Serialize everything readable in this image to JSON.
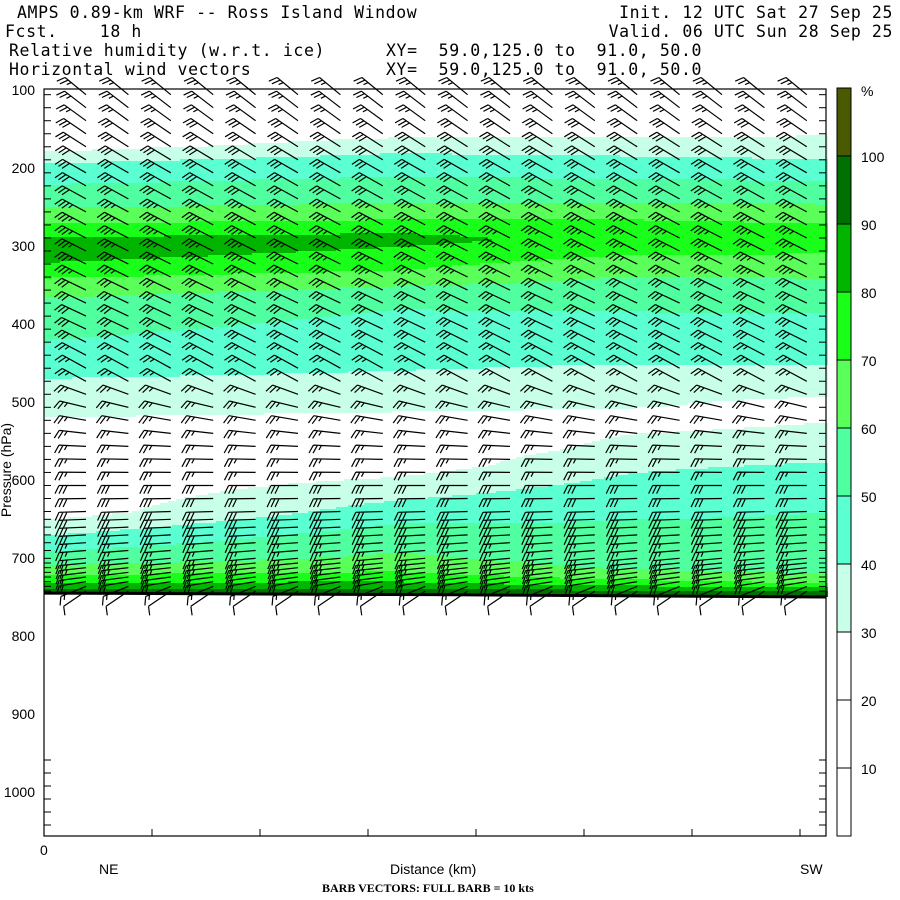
{
  "header": {
    "title": "AMPS 0.89-km WRF -- Ross Island Window",
    "init": "Init. 12 UTC Sat 27 Sep 25",
    "fcst": "Fcst.    18 h",
    "valid": "Valid. 06 UTC Sun 28 Sep 25",
    "field1": "Relative humidity (w.r.t. ice)",
    "field1_xy": "XY=  59.0,125.0 to  91.0, 50.0",
    "field2": "Horizontal wind vectors",
    "field2_xy": "XY=  59.0,125.0 to  91.0, 50.0"
  },
  "chart_data": {
    "type": "heatmap",
    "title": "Relative humidity (w.r.t. ice) and horizontal wind vectors cross-section",
    "ylabel": "Pressure (hPa)",
    "ylim": [
      100,
      1056
    ],
    "y_tick_values": [
      100,
      200,
      300,
      400,
      500,
      600,
      700,
      800,
      900,
      1000
    ],
    "y_ticks": [
      "100",
      "200",
      "300",
      "400",
      "500",
      "600",
      "700",
      "800",
      "900",
      "1000"
    ],
    "x_origin_label": "0",
    "x_left_label": "NE",
    "xlabel": "Distance (km)",
    "x_right_label": "SW",
    "x_major_ticks": 7,
    "footer": "BARB VECTORS:  FULL BARB = 10 kts",
    "colorbar": {
      "unit": "%",
      "levels": [
        10,
        20,
        30,
        40,
        50,
        60,
        70,
        80,
        90,
        100
      ],
      "labels": [
        "10",
        "20",
        "30",
        "40",
        "50",
        "60",
        "70",
        "80",
        "90",
        "100"
      ],
      "colors": [
        "#ffffff",
        "#ffffff",
        "#ffffff",
        "#c8ffe8",
        "#5affd2",
        "#50ffa0",
        "#5aff5a",
        "#1aff1a",
        "#00b400",
        "#007000",
        "#4a5a00"
      ]
    },
    "surface_pressure": [
      [
        0,
        745
      ],
      [
        0.5,
        747
      ],
      [
        1,
        750
      ]
    ],
    "rh_profiles": [
      {
        "x": 0.0,
        "points": [
          [
            100,
            10
          ],
          [
            170,
            25
          ],
          [
            185,
            35
          ],
          [
            200,
            45
          ],
          [
            240,
            55
          ],
          [
            260,
            65
          ],
          [
            280,
            75
          ],
          [
            300,
            88
          ],
          [
            320,
            80
          ],
          [
            350,
            65
          ],
          [
            380,
            55
          ],
          [
            420,
            50
          ],
          [
            460,
            42
          ],
          [
            490,
            35
          ],
          [
            530,
            28
          ],
          [
            580,
            22
          ],
          [
            640,
            25
          ],
          [
            660,
            35
          ],
          [
            680,
            45
          ],
          [
            700,
            55
          ],
          [
            715,
            65
          ],
          [
            725,
            75
          ],
          [
            735,
            85
          ],
          [
            742,
            95
          ],
          [
            750,
            105
          ]
        ]
      },
      {
        "x": 0.45,
        "points": [
          [
            100,
            10
          ],
          [
            150,
            25
          ],
          [
            170,
            35
          ],
          [
            190,
            45
          ],
          [
            230,
            55
          ],
          [
            255,
            65
          ],
          [
            275,
            75
          ],
          [
            290,
            85
          ],
          [
            300,
            80
          ],
          [
            330,
            70
          ],
          [
            350,
            60
          ],
          [
            380,
            50
          ],
          [
            430,
            45
          ],
          [
            470,
            38
          ],
          [
            500,
            32
          ],
          [
            540,
            25
          ],
          [
            580,
            25
          ],
          [
            610,
            35
          ],
          [
            640,
            45
          ],
          [
            670,
            55
          ],
          [
            700,
            62
          ],
          [
            720,
            72
          ],
          [
            735,
            85
          ],
          [
            745,
            105
          ]
        ]
      },
      {
        "x": 0.75,
        "points": [
          [
            100,
            10
          ],
          [
            145,
            25
          ],
          [
            172,
            35
          ],
          [
            195,
            45
          ],
          [
            230,
            55
          ],
          [
            255,
            65
          ],
          [
            275,
            75
          ],
          [
            305,
            72
          ],
          [
            330,
            62
          ],
          [
            355,
            55
          ],
          [
            400,
            47
          ],
          [
            450,
            40
          ],
          [
            480,
            34
          ],
          [
            520,
            28
          ],
          [
            560,
            32
          ],
          [
            590,
            40
          ],
          [
            630,
            48
          ],
          [
            680,
            53
          ],
          [
            710,
            58
          ],
          [
            725,
            68
          ],
          [
            738,
            85
          ],
          [
            748,
            105
          ]
        ]
      },
      {
        "x": 1.0,
        "points": [
          [
            100,
            10
          ],
          [
            140,
            25
          ],
          [
            175,
            35
          ],
          [
            200,
            45
          ],
          [
            230,
            55
          ],
          [
            260,
            65
          ],
          [
            280,
            75
          ],
          [
            300,
            72
          ],
          [
            330,
            65
          ],
          [
            350,
            55
          ],
          [
            400,
            48
          ],
          [
            450,
            40
          ],
          [
            470,
            35
          ],
          [
            500,
            28
          ],
          [
            550,
            32
          ],
          [
            570,
            38
          ],
          [
            590,
            45
          ],
          [
            640,
            50
          ],
          [
            680,
            52
          ],
          [
            710,
            55
          ],
          [
            730,
            68
          ],
          [
            745,
            95
          ],
          [
            752,
            105
          ]
        ]
      }
    ],
    "wind_columns": 18,
    "wind_profile": [
      [
        100,
        310,
        25
      ],
      [
        200,
        300,
        30
      ],
      [
        300,
        297,
        35
      ],
      [
        400,
        295,
        30
      ],
      [
        470,
        300,
        25
      ],
      [
        500,
        285,
        25
      ],
      [
        560,
        272,
        25
      ],
      [
        650,
        268,
        30
      ],
      [
        700,
        265,
        25
      ],
      [
        730,
        262,
        20
      ],
      [
        745,
        230,
        10
      ]
    ]
  }
}
